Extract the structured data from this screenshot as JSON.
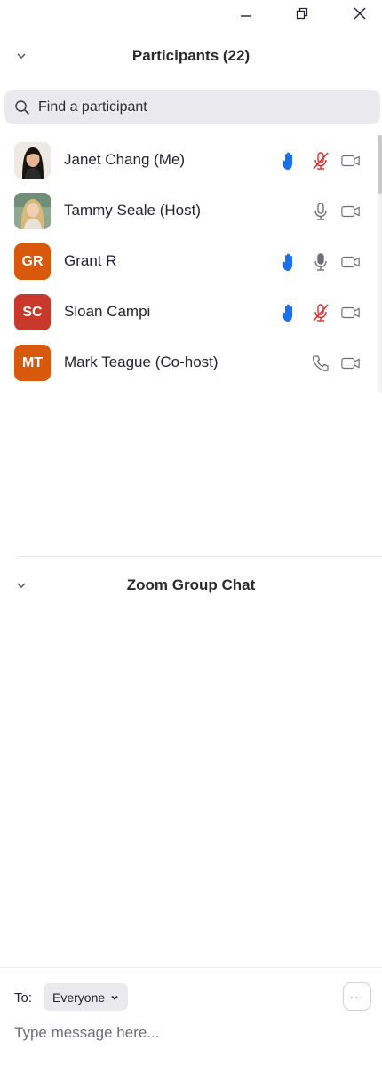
{
  "window": {
    "minimize_icon": "minimize-icon",
    "restore_icon": "restore-icon",
    "close_icon": "close-icon"
  },
  "participants_panel": {
    "title": "Participants (22)",
    "search": {
      "placeholder": "Find a participant",
      "value": ""
    },
    "list": [
      {
        "name": "Janet Chang (Me)",
        "avatar_type": "photo",
        "hand_raised": true,
        "audio": "muted",
        "video": "off"
      },
      {
        "name": "Tammy Seale (Host)",
        "avatar_type": "photo",
        "hand_raised": false,
        "audio": "unmuted",
        "video": "off"
      },
      {
        "name": "Grant R",
        "avatar_type": "initials",
        "initials": "GR",
        "avatar_color": "#d8590b",
        "hand_raised": true,
        "audio": "unmuted",
        "video": "off"
      },
      {
        "name": "Sloan Campi",
        "avatar_type": "initials",
        "initials": "SC",
        "avatar_color": "#c8382b",
        "hand_raised": true,
        "audio": "muted",
        "video": "off"
      },
      {
        "name": "Mark Teague (Co-host)",
        "avatar_type": "initials",
        "initials": "MT",
        "avatar_color": "#d8590b",
        "hand_raised": false,
        "audio": "phone",
        "video": "off"
      }
    ]
  },
  "chat_panel": {
    "title": "Zoom Group Chat",
    "to_label": "To:",
    "recipient": "Everyone",
    "message_placeholder": "Type message here...",
    "more_label": "···"
  },
  "colors": {
    "hand_blue": "#1d6fe8",
    "muted_red": "#e02828",
    "icon_gray": "#6e6e78",
    "search_bg": "#e9e9ee"
  }
}
